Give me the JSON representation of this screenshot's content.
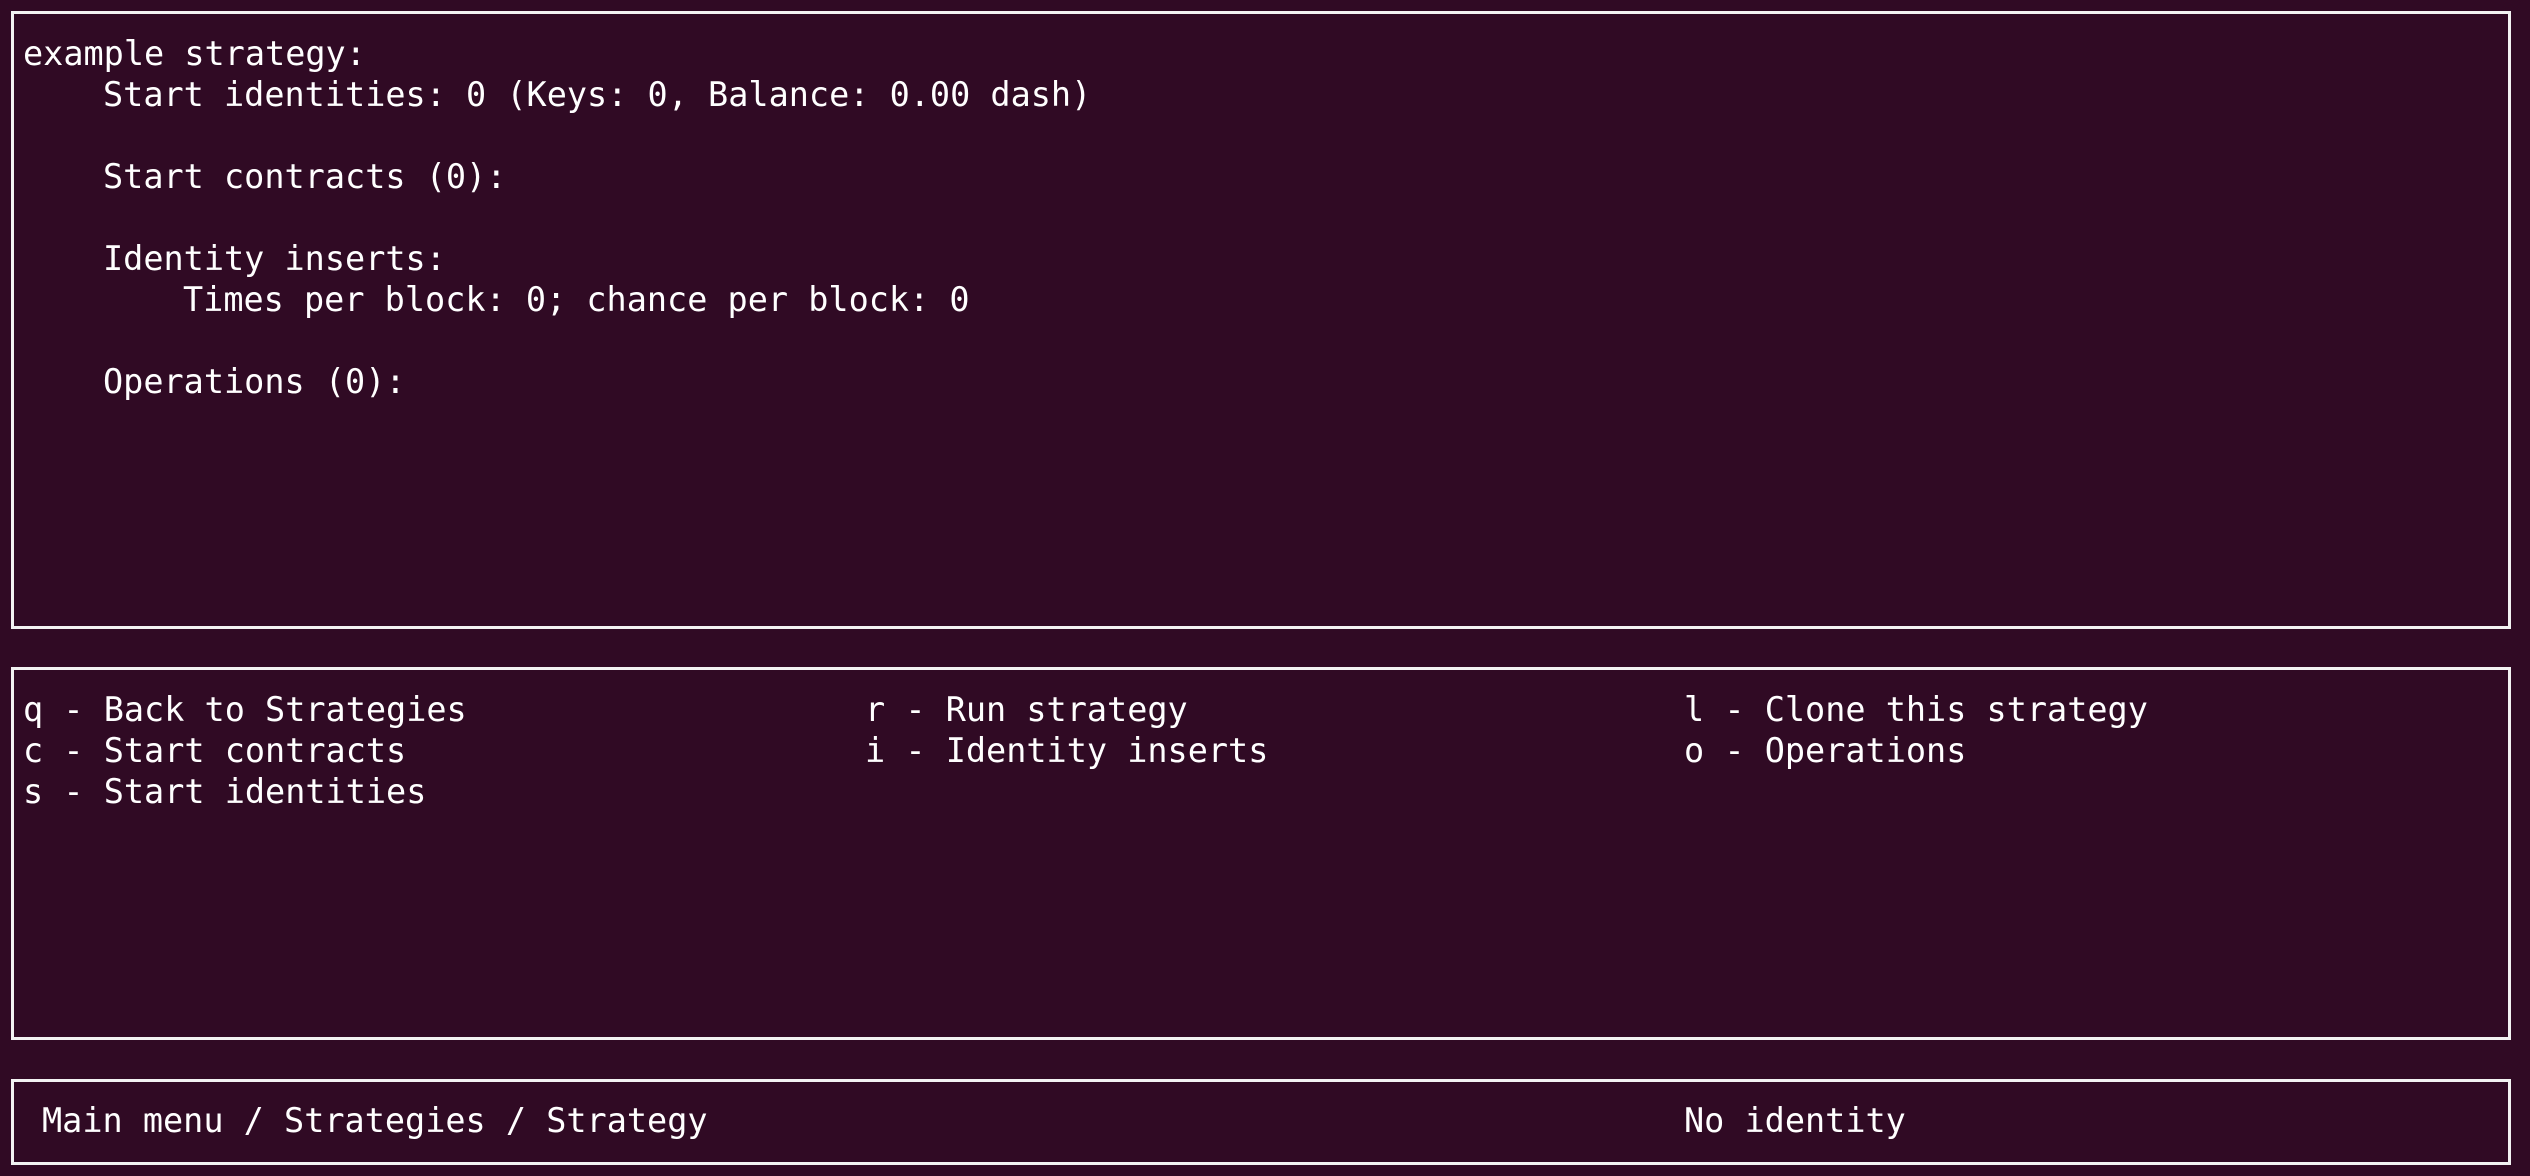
{
  "strategy": {
    "title": "example strategy:",
    "start_identities": "Start identities: 0 (Keys: 0, Balance: 0.00 dash)",
    "start_contracts": "Start contracts (0):",
    "identity_inserts": "Identity inserts:",
    "times_per_block": "Times per block: 0; chance per block: 0",
    "operations": "Operations (0):"
  },
  "keys": {
    "col1": [
      {
        "key": "q",
        "label": "Back to Strategies"
      },
      {
        "key": "c",
        "label": "Start contracts"
      },
      {
        "key": "s",
        "label": "Start identities"
      }
    ],
    "col2": [
      {
        "key": "r",
        "label": "Run strategy"
      },
      {
        "key": "i",
        "label": "Identity inserts"
      }
    ],
    "col3": [
      {
        "key": "l",
        "label": "Clone this strategy"
      },
      {
        "key": "o",
        "label": "Operations"
      }
    ],
    "separator": " - "
  },
  "status": {
    "breadcrumb": "Main menu / Strategies / Strategy",
    "identity": "No identity"
  },
  "colors": {
    "background": "#300a24",
    "foreground": "#ffffff",
    "border": "#f2f2f2"
  }
}
